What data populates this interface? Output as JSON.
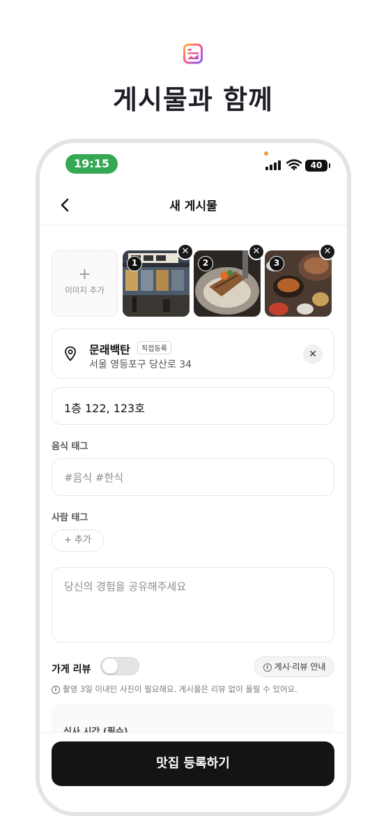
{
  "hero": {
    "title": "게시물과 함께",
    "icon": "gallery-icon"
  },
  "status": {
    "time": "19:15",
    "battery": "40",
    "accent": "#34a853"
  },
  "nav": {
    "title": "새 게시물"
  },
  "photos": {
    "add_plus": "+",
    "add_label": "이미지 추가",
    "items": [
      {
        "badge": "1",
        "remove": "✕"
      },
      {
        "badge": "2",
        "remove": "✕"
      },
      {
        "badge": "3",
        "remove": "✕"
      }
    ]
  },
  "location": {
    "name": "문래백탄",
    "chip": "직접등록",
    "address": "서울 영등포구 당산로 34",
    "clear": "✕"
  },
  "detail": {
    "value": "1층 122, 123호"
  },
  "food_tag": {
    "label": "음식 태그",
    "placeholder": "#음식 #한식"
  },
  "people_tag": {
    "label": "사람 태그",
    "add": "+ 추가"
  },
  "review_text": {
    "placeholder": "당신의 경험을 공유해주세요"
  },
  "store_review": {
    "label": "가게 리뷰",
    "enabled": false,
    "guide": "게시·리뷰 안내",
    "info_glyph": "i"
  },
  "notice": {
    "text": "촬영 3일 이내인 사진이 필요해요. 게시물은 리뷰 없이 올릴 수 있어요.",
    "info_glyph": "i"
  },
  "meal_time": {
    "label": "식사 시간 (필수)"
  },
  "submit": {
    "label": "맛집 등록하기"
  }
}
